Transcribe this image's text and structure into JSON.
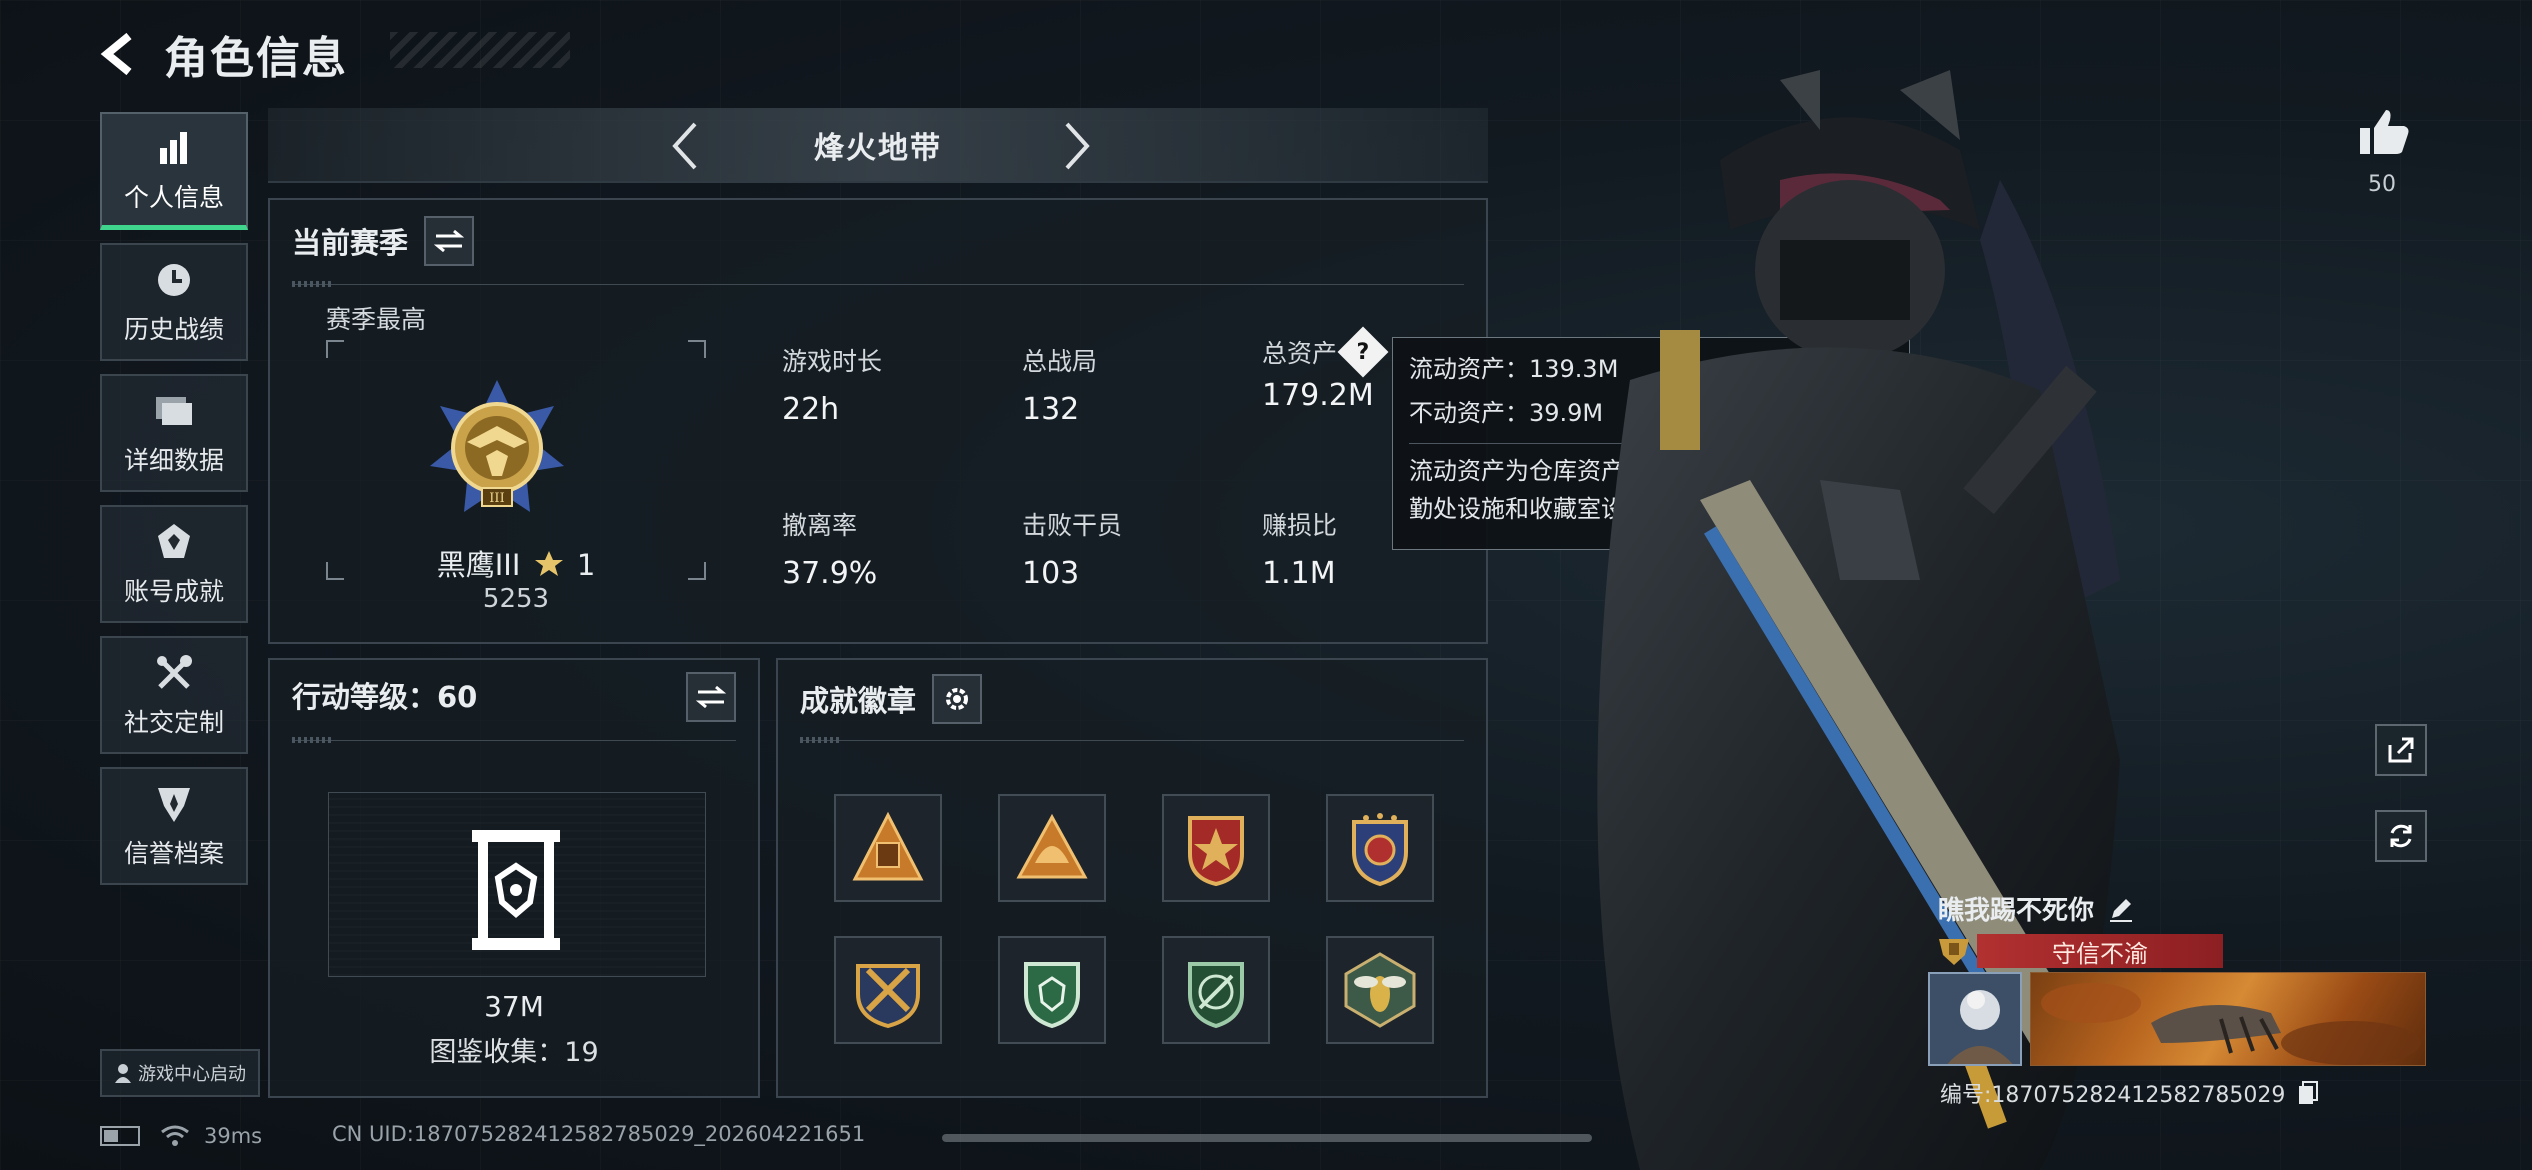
{
  "header": {
    "title": "角色信息"
  },
  "nav": {
    "items": [
      {
        "label": "个人信息",
        "icon": "bar-chart-icon",
        "active": true
      },
      {
        "label": "历史战绩",
        "icon": "clock-icon"
      },
      {
        "label": "详细数据",
        "icon": "folder-icon"
      },
      {
        "label": "账号成就",
        "icon": "achievement-icon"
      },
      {
        "label": "社交定制",
        "icon": "tools-icon"
      },
      {
        "label": "信誉档案",
        "icon": "credit-icon"
      }
    ],
    "launch_label": "游戏中心启动"
  },
  "mode": {
    "title": "烽火地带"
  },
  "season": {
    "title": "当前赛季",
    "subtitle": "赛季最高",
    "rank_name": "黑鹰III",
    "rank_stars": "1",
    "rank_points": "5253",
    "stats": [
      {
        "label": "游戏时长",
        "value": "22h"
      },
      {
        "label": "总战局",
        "value": "132"
      },
      {
        "label": "总资产",
        "value": "179.2M"
      },
      {
        "label": "撤离率",
        "value": "37.9%"
      },
      {
        "label": "击败干员",
        "value": "103"
      },
      {
        "label": "赚损比",
        "value": "1.1M"
      }
    ],
    "help_glyph": "?"
  },
  "tooltip": {
    "line1": "流动资产：139.3M",
    "line2": "不动资产：39.9M",
    "desc": "流动资产为仓库资产和哈夫币，不动资产为特勤处设施和收藏室设施"
  },
  "action": {
    "title": "行动等级：60",
    "collection_value": "37M",
    "collection_label": "图鉴收集：19"
  },
  "medals": {
    "title": "成就徽章",
    "items": [
      "pyramid-medal",
      "helmet-medal",
      "star-medal",
      "shield-medal",
      "crossed-medal",
      "green-shield-medal",
      "target-medal",
      "wasp-medal"
    ]
  },
  "profile": {
    "like_count": "50",
    "player_name": "瞧我踢不死你",
    "title_plate": "守信不渝",
    "id_text": "编号:187075282412582785029"
  },
  "status": {
    "ping": "39ms",
    "uid": "CN UID:187075282412582785029_202604221651"
  },
  "colors": {
    "accent": "#3fd58c",
    "title_plate": "#b23030"
  }
}
